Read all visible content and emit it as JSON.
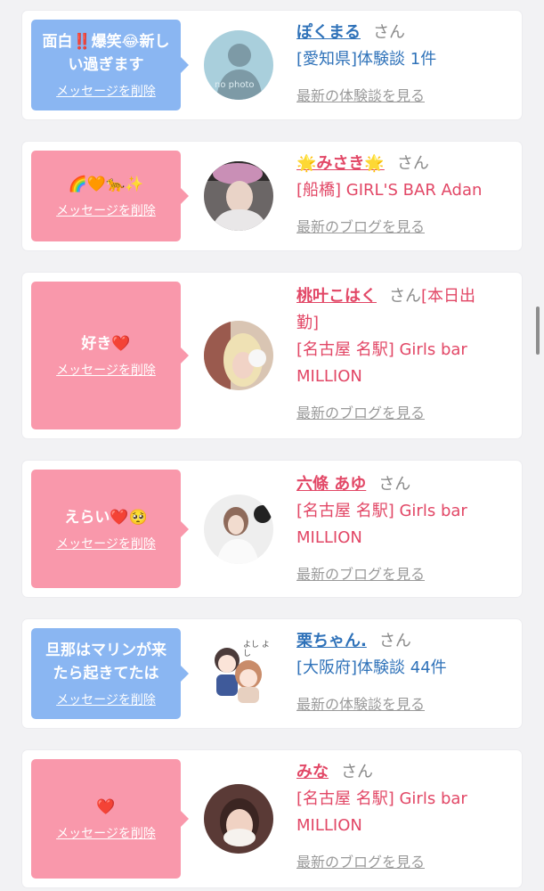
{
  "messages": [
    {
      "text": "面白‼️爆笑😂新しい過ぎます",
      "delete_label": "メッセージを削除",
      "name": "ぽくまる",
      "san": "さん",
      "sub": "[愛知県]体験談 1件",
      "more": "最新の体験談を見る",
      "avatar_text": "no photo"
    },
    {
      "text": "🌈🧡🐆✨",
      "delete_label": "メッセージを削除",
      "name": "🌟みさき🌟",
      "san": "さん",
      "sub": "[船橋] GIRL'S BAR Adan",
      "more": "最新のブログを見る"
    },
    {
      "text": "好き❤️",
      "delete_label": "メッセージを削除",
      "name": "桃叶こはく",
      "san": "さん",
      "name_suffix": "[本日出",
      "sub_first": "勤]",
      "sub": "[名古屋 名駅] Girls bar",
      "sub2": "MILLION",
      "more": "最新のブログを見る"
    },
    {
      "text": "えらい❤️🥺",
      "delete_label": "メッセージを削除",
      "name": "六條 あゆ",
      "san": "さん",
      "sub": "[名古屋 名駅] Girls bar",
      "sub2": "MILLION",
      "more": "最新のブログを見る"
    },
    {
      "text": "旦那はマリンが来たら起きてたは",
      "delete_label": "メッセージを削除",
      "name": "栗ちゃん.",
      "san": "さん",
      "sub": "[大阪府]体験談 44件",
      "more": "最新の体験談を見る",
      "avatar_text": "よし よし"
    },
    {
      "text": "❤️",
      "delete_label": "メッセージを削除",
      "name": "みな",
      "san": "さん",
      "sub": "[名古屋 名駅] Girls bar",
      "sub2": "MILLION",
      "more": "最新のブログを見る"
    }
  ],
  "colors": {
    "blue_bubble": "#8ab6f2",
    "pink_bubble": "#f998ab",
    "blue_text": "#2f72b9",
    "pink_text": "#e24766"
  }
}
